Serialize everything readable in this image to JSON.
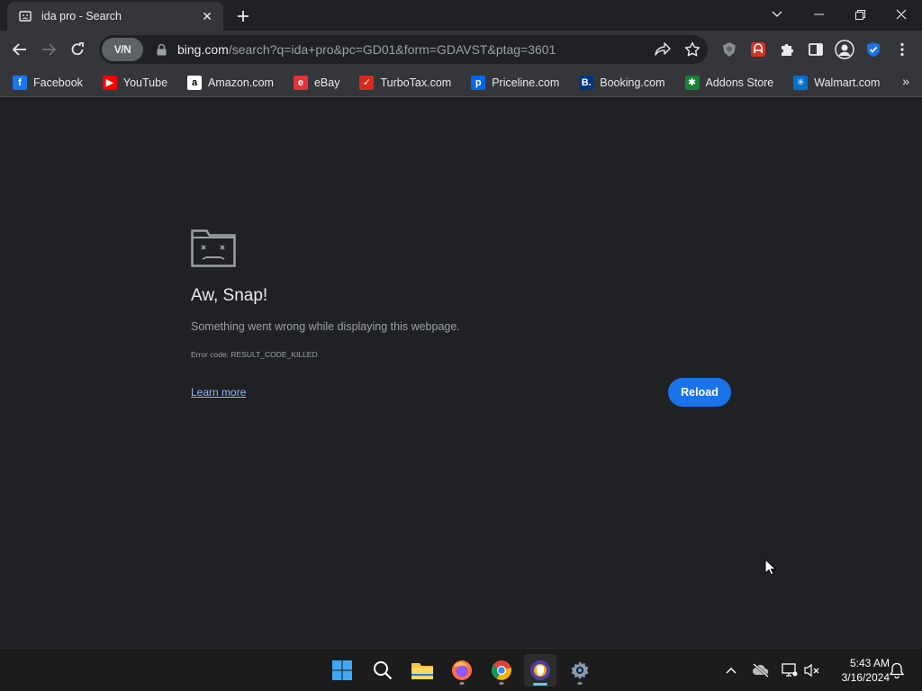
{
  "tab": {
    "title": "ida pro - Search",
    "favicon": "sad-page-icon"
  },
  "toolbar": {
    "vpn_label": "V/N",
    "url_host": "bing.com",
    "url_path": "/search?q=ida+pro&pc=GD01&form=GDAVST&ptag=3601"
  },
  "bookmarks": [
    {
      "label": "Facebook",
      "icon": "facebook-icon",
      "color": "#1877f2",
      "glyph": "f"
    },
    {
      "label": "YouTube",
      "icon": "youtube-icon",
      "color": "#ff0000",
      "glyph": "▶"
    },
    {
      "label": "Amazon.com",
      "icon": "amazon-icon",
      "color": "#ffffff",
      "glyph": "a"
    },
    {
      "label": "eBay",
      "icon": "ebay-icon",
      "color": "#e53238",
      "glyph": "e"
    },
    {
      "label": "TurboTax.com",
      "icon": "turbotax-icon",
      "color": "#d52b1e",
      "glyph": "✓"
    },
    {
      "label": "Priceline.com",
      "icon": "priceline-icon",
      "color": "#0068ef",
      "glyph": "p"
    },
    {
      "label": "Booking.com",
      "icon": "booking-icon",
      "color": "#003580",
      "glyph": "B."
    },
    {
      "label": "Addons Store",
      "icon": "addons-store-icon",
      "color": "#188038",
      "glyph": "✱"
    },
    {
      "label": "Walmart.com",
      "icon": "walmart-icon",
      "color": "#0071ce",
      "glyph": "✳"
    }
  ],
  "error": {
    "title": "Aw, Snap!",
    "message": "Something went wrong while displaying this webpage.",
    "code": "Error code: RESULT_CODE_KILLED",
    "learn_more": "Learn more",
    "reload": "Reload"
  },
  "taskbar": {
    "time": "5:43 AM",
    "date": "3/16/2024"
  },
  "colors": {
    "accent": "#1a73e8",
    "link": "#8ab4f8",
    "page_bg": "#202124",
    "toolbar_bg": "#35363a"
  }
}
